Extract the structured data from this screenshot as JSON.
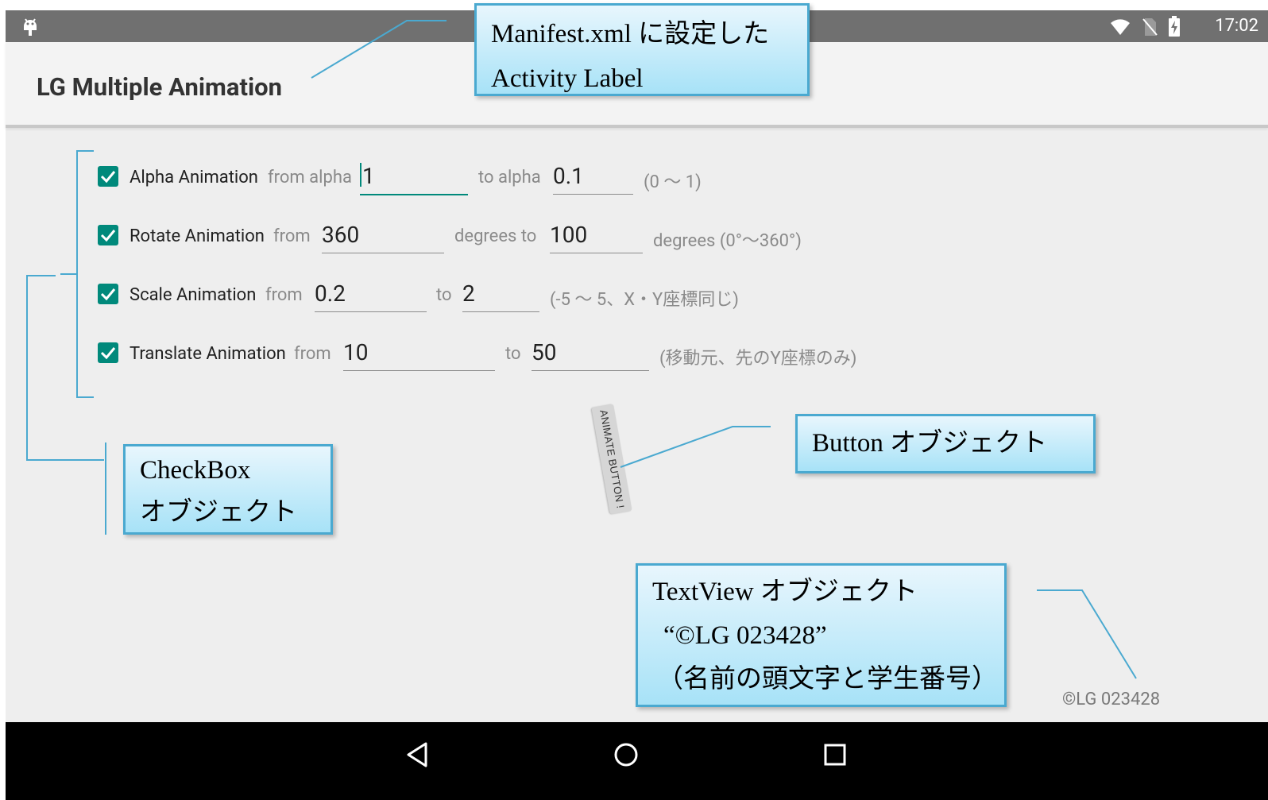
{
  "status_bar": {
    "time": "17:02",
    "icons": [
      "android-debug-icon",
      "wifi-icon",
      "no-sim-icon",
      "battery-charging-icon"
    ]
  },
  "app_bar": {
    "title": "LG Multiple Animation"
  },
  "rows": [
    {
      "checked": true,
      "label": "Alpha Animation",
      "from_text": "from alpha",
      "from_value": "1",
      "mid_text": "to alpha",
      "to_value": "0.1",
      "hint": "(0 〜 1)"
    },
    {
      "checked": true,
      "label": "Rotate Animation",
      "from_text": "from",
      "from_value": "360",
      "mid_text": "degrees to",
      "to_value": "100",
      "hint": "degrees (0°〜360°)"
    },
    {
      "checked": true,
      "label": "Scale Animation",
      "from_text": "from",
      "from_value": "0.2",
      "mid_text": "to",
      "to_value": "2",
      "hint": "(-5 〜 5、X・Y座標同じ)"
    },
    {
      "checked": true,
      "label": "Translate Animation",
      "from_text": "from",
      "from_value": "10",
      "mid_text": "to",
      "to_value": "50",
      "hint": "(移動元、先のY座標のみ)"
    }
  ],
  "animate_button": {
    "label": "ANIMATE BUTTON !"
  },
  "copyright_text": "©LG 023428",
  "callouts": {
    "manifest": [
      "Manifest.xml に設定した",
      "Activity Label"
    ],
    "checkbox": [
      "CheckBox",
      "オブジェクト"
    ],
    "button": [
      "Button オブジェクト"
    ],
    "textview": [
      "TextView オブジェクト",
      "“©LG 023428”",
      "（名前の頭文字と学生番号）"
    ]
  },
  "nav_bar": {
    "icons": [
      "back-icon",
      "home-icon",
      "recents-icon"
    ]
  },
  "colors": {
    "accent": "#00897b",
    "status_bar": "#707070",
    "callout_border": "#4aa9d0",
    "callout_fill": "#a7e2f7"
  }
}
